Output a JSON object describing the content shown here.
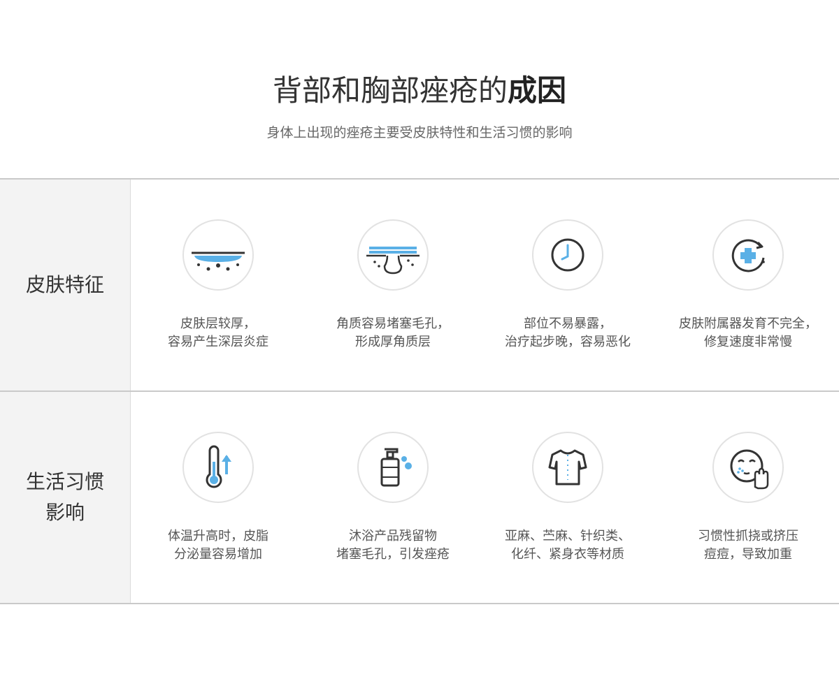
{
  "header": {
    "title_regular": "背部和胸部痤疮的",
    "title_bold": "成因",
    "subtitle": "身体上出现的痤疮主要受皮肤特性和生活习惯的影响"
  },
  "colors": {
    "accent": "#5ab0e6",
    "icon_dark": "#333333",
    "label_bg": "#f3f3f3",
    "divider": "#c9c9c9"
  },
  "rows": [
    {
      "label_lines": [
        "皮肤特征"
      ],
      "cells": [
        {
          "icon": "skin-layer-icon",
          "lines": [
            "皮肤层较厚，",
            "容易产生深层炎症"
          ]
        },
        {
          "icon": "clogged-pore-icon",
          "lines": [
            "角质容易堵塞毛孔，",
            "形成厚角质层"
          ]
        },
        {
          "icon": "clock-icon",
          "lines": [
            "部位不易暴露，",
            "治疗起步晚，容易恶化"
          ]
        },
        {
          "icon": "regeneration-cross-icon",
          "lines": [
            "皮肤附属器发育不完全，",
            "修复速度非常慢"
          ]
        }
      ]
    },
    {
      "label_lines": [
        "生活习惯",
        "影响"
      ],
      "cells": [
        {
          "icon": "thermometer-icon",
          "lines": [
            "体温升高时，皮脂",
            "分泌量容易增加"
          ]
        },
        {
          "icon": "soap-bottle-icon",
          "lines": [
            "沐浴产品残留物",
            "堵塞毛孔，引发痤疮"
          ]
        },
        {
          "icon": "shirt-icon",
          "lines": [
            "亚麻、苎麻、针织类、",
            "化纤、紧身衣等材质"
          ]
        },
        {
          "icon": "face-touch-icon",
          "lines": [
            "习惯性抓挠或挤压",
            "痘痘，导致加重"
          ]
        }
      ]
    }
  ]
}
